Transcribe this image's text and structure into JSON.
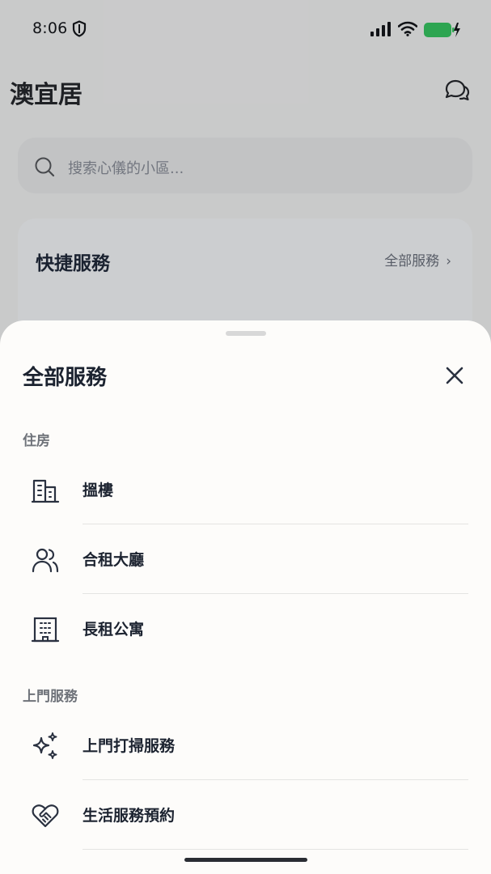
{
  "status_bar": {
    "time": "8:06",
    "icons": [
      "shield-icon",
      "signal-icon",
      "wifi-icon",
      "battery-charging-icon"
    ],
    "battery_color": "#34c759"
  },
  "app": {
    "title": "澳宜居",
    "search_placeholder": "搜索心儀的小區...",
    "quick_services": {
      "title": "快捷服務",
      "all_link": "全部服務",
      "chevron": "›"
    }
  },
  "sheet": {
    "title": "全部服務",
    "close_icon": "close-icon",
    "sections": [
      {
        "label": "住房",
        "items": [
          {
            "label": "搵樓",
            "icon": "building-icon"
          },
          {
            "label": "合租大廳",
            "icon": "users-icon"
          },
          {
            "label": "長租公寓",
            "icon": "apartment-icon"
          }
        ]
      },
      {
        "label": "上門服務",
        "items": [
          {
            "label": "上門打掃服務",
            "icon": "sparkles-icon"
          },
          {
            "label": "生活服務預約",
            "icon": "heart-handshake-icon"
          }
        ]
      }
    ]
  },
  "colors": {
    "sheet_bg": "#fdfcfa",
    "text_primary": "#1c2330",
    "text_secondary": "#6f737a",
    "overlay": "rgba(20,30,50,0.20)"
  }
}
